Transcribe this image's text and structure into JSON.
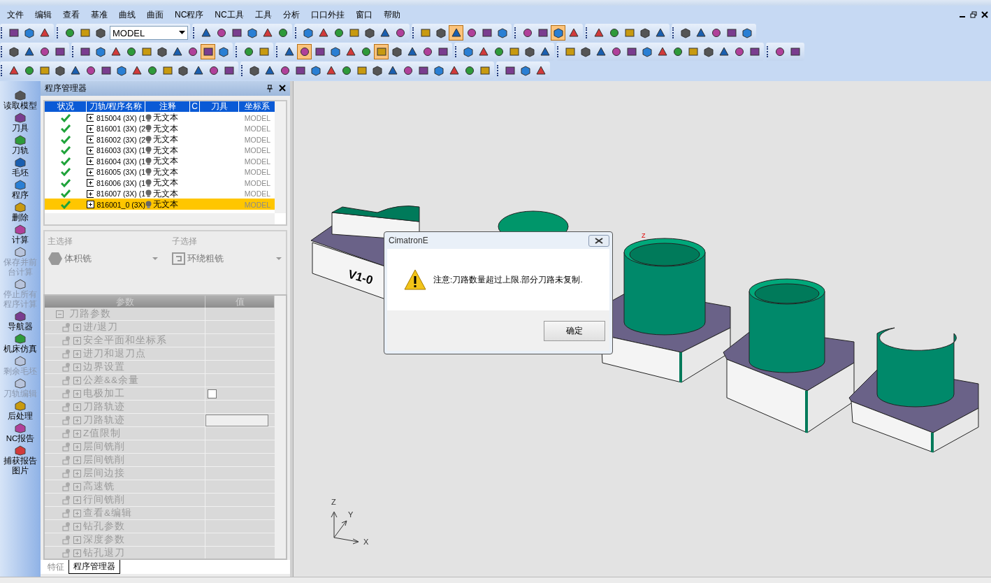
{
  "menu": [
    "文件",
    "编辑",
    "查看",
    "基准",
    "曲线",
    "曲面",
    "NC程序",
    "NC工具",
    "工具",
    "分析",
    "口口外挂",
    "窗口",
    "帮助"
  ],
  "toolbars": [
    {
      "groups": [
        {
          "buttons": [
            {
              "selected": false
            },
            {
              "selected": false
            },
            {
              "selected": false
            }
          ]
        },
        {
          "buttons": [
            {
              "selected": false
            },
            {
              "selected": false
            },
            {
              "selected": false
            }
          ],
          "combo": {
            "value": "MODEL"
          }
        },
        {
          "buttons": [
            {
              "selected": false
            },
            {
              "selected": false
            },
            {
              "selected": false
            },
            {
              "selected": false
            },
            {
              "selected": false
            },
            {
              "selected": false
            }
          ]
        },
        {
          "buttons": [
            {
              "selected": false
            },
            {
              "selected": false
            },
            {
              "selected": false
            },
            {
              "selected": false
            },
            {
              "selected": false
            },
            {
              "selected": false
            },
            {
              "selected": false
            }
          ]
        },
        {
          "buttons": [
            {
              "selected": false
            },
            {
              "selected": false
            },
            {
              "selected": true
            },
            {
              "selected": false
            },
            {
              "selected": false
            },
            {
              "selected": false
            }
          ]
        },
        {
          "buttons": [
            {
              "selected": false
            },
            {
              "selected": false
            },
            {
              "selected": true
            },
            {
              "selected": false
            }
          ]
        },
        {
          "buttons": [
            {
              "selected": false
            },
            {
              "selected": false
            },
            {
              "selected": false
            },
            {
              "selected": false
            },
            {
              "selected": false
            }
          ]
        },
        {
          "buttons": [
            {
              "selected": false
            },
            {
              "selected": false
            },
            {
              "selected": false
            },
            {
              "selected": false
            },
            {
              "selected": false
            }
          ]
        }
      ]
    },
    {
      "groups": [
        {
          "buttons": [
            {
              "selected": false
            },
            {
              "selected": false
            },
            {
              "selected": false
            },
            {
              "selected": false
            }
          ]
        },
        {
          "buttons": [
            {
              "selected": false
            },
            {
              "selected": false
            },
            {
              "selected": false
            },
            {
              "selected": false
            },
            {
              "selected": false
            },
            {
              "selected": false
            },
            {
              "selected": false
            },
            {
              "selected": false
            },
            {
              "selected": true
            },
            {
              "selected": false
            }
          ]
        },
        {
          "buttons": [
            {
              "selected": false
            },
            {
              "selected": false
            }
          ]
        },
        {
          "buttons": [
            {
              "selected": false
            },
            {
              "selected": true
            },
            {
              "selected": false
            },
            {
              "selected": false
            },
            {
              "selected": false
            },
            {
              "selected": false
            },
            {
              "selected": true
            },
            {
              "selected": false
            },
            {
              "selected": false
            },
            {
              "selected": false
            },
            {
              "selected": false
            }
          ]
        },
        {
          "buttons": [
            {
              "selected": false
            },
            {
              "selected": false
            },
            {
              "selected": false
            },
            {
              "selected": false
            },
            {
              "selected": false
            },
            {
              "selected": false
            }
          ]
        },
        {
          "buttons": [
            {
              "selected": false
            },
            {
              "selected": false
            },
            {
              "selected": false
            },
            {
              "selected": false
            },
            {
              "selected": false
            },
            {
              "selected": false
            },
            {
              "selected": false
            },
            {
              "selected": false
            },
            {
              "selected": false
            },
            {
              "selected": false
            },
            {
              "selected": false
            },
            {
              "selected": false
            },
            {
              "selected": false
            }
          ]
        },
        {
          "buttons": [
            {
              "selected": false
            },
            {
              "selected": false
            }
          ]
        }
      ]
    },
    {
      "groups": [
        {
          "buttons": [
            {
              "selected": false
            },
            {
              "selected": false
            },
            {
              "selected": false
            },
            {
              "selected": false
            },
            {
              "selected": false
            },
            {
              "selected": false
            },
            {
              "selected": false
            },
            {
              "selected": false
            },
            {
              "selected": false
            },
            {
              "selected": false
            },
            {
              "selected": false
            },
            {
              "selected": false
            },
            {
              "selected": false
            },
            {
              "selected": false
            },
            {
              "selected": false
            }
          ]
        },
        {
          "buttons": [
            {
              "selected": false
            },
            {
              "selected": false
            },
            {
              "selected": false
            },
            {
              "selected": false
            },
            {
              "selected": false
            },
            {
              "selected": false
            },
            {
              "selected": false
            },
            {
              "selected": false
            },
            {
              "selected": false
            },
            {
              "selected": false
            },
            {
              "selected": false
            },
            {
              "selected": false
            },
            {
              "selected": false
            },
            {
              "selected": false
            },
            {
              "selected": false
            },
            {
              "selected": false
            }
          ]
        },
        {
          "buttons": [
            {
              "selected": false
            },
            {
              "selected": false
            },
            {
              "selected": false
            }
          ]
        }
      ]
    }
  ],
  "sidebar": {
    "items": [
      {
        "label": "读取模型",
        "disabled": false
      },
      {
        "label": "刀具",
        "disabled": false
      },
      {
        "label": "刀轨",
        "disabled": false
      },
      {
        "label": "毛坯",
        "disabled": false
      },
      {
        "label": "程序",
        "disabled": false
      },
      {
        "label": "删除",
        "disabled": false
      },
      {
        "label": "计算",
        "disabled": false
      },
      {
        "label": "保存并前台计算",
        "disabled": true
      },
      {
        "label": "停止所有程序计算",
        "disabled": true
      },
      {
        "label": "导航器",
        "disabled": false
      },
      {
        "label": "机床仿真",
        "disabled": false
      },
      {
        "label": "剩余毛坯",
        "disabled": true
      },
      {
        "label": "刀轨编辑",
        "disabled": true
      },
      {
        "label": "后处理",
        "disabled": false
      },
      {
        "label": "NC报告",
        "disabled": false
      },
      {
        "label": "捕获报告图片",
        "disabled": false
      }
    ]
  },
  "panel": {
    "title": "程序管理器",
    "table": {
      "columns": [
        "状况",
        "刀轨/程序名称",
        "注释",
        "C",
        "刀具",
        "坐标系"
      ],
      "rows": [
        {
          "name": "815004 (3X) (1",
          "comment": "无文本",
          "coord": "MODEL",
          "selected": false
        },
        {
          "name": "816001 (3X) (2",
          "comment": "无文本",
          "coord": "MODEL",
          "selected": false
        },
        {
          "name": "816002 (3X) (2",
          "comment": "无文本",
          "coord": "MODEL",
          "selected": false
        },
        {
          "name": "816003 (3X) (1",
          "comment": "无文本",
          "coord": "MODEL",
          "selected": false
        },
        {
          "name": "816004 (3X) (1",
          "comment": "无文本",
          "coord": "MODEL",
          "selected": false
        },
        {
          "name": "816005 (3X) (1",
          "comment": "无文本",
          "coord": "MODEL",
          "selected": false
        },
        {
          "name": "816006 (3X) (1",
          "comment": "无文本",
          "coord": "MODEL",
          "selected": false
        },
        {
          "name": "816007 (3X) (1",
          "comment": "无文本",
          "coord": "MODEL",
          "selected": false
        },
        {
          "name": "816001_0 (3X)",
          "comment": "无文本",
          "coord": "MODEL",
          "selected": true
        }
      ]
    },
    "main_selection": {
      "label": "主选择",
      "value": "体积铣"
    },
    "sub_selection": {
      "label": "子选择",
      "value": "环绕粗铣"
    },
    "params": {
      "columns": [
        "参数",
        "值"
      ],
      "root": {
        "label": "刀路参数",
        "expanded": true,
        "children": [
          {
            "label": "进/退刀",
            "kind": "plain",
            "expanded": false
          },
          {
            "label": "安全平面和坐标系",
            "kind": "plain",
            "expanded": false
          },
          {
            "label": "进刀和退刀点",
            "kind": "plain",
            "expanded": false
          },
          {
            "label": "边界设置",
            "kind": "plain",
            "expanded": false
          },
          {
            "label": "公差&&余量",
            "kind": "plain",
            "expanded": false
          },
          {
            "label": "电极加工",
            "kind": "checkbox",
            "checked": false,
            "expanded": false
          },
          {
            "label": "刀路轨迹",
            "kind": "plain",
            "expanded": false
          },
          {
            "label": "刀路轨迹",
            "kind": "field",
            "expanded": false
          },
          {
            "label": "Z值限制",
            "kind": "plain",
            "expanded": false
          },
          {
            "label": "层间铣削",
            "kind": "plain",
            "expanded": false
          },
          {
            "label": "层间铣削",
            "kind": "plain",
            "expanded": false
          },
          {
            "label": "层间边接",
            "kind": "plain",
            "expanded": false
          },
          {
            "label": "高速铣",
            "kind": "plain",
            "expanded": false
          },
          {
            "label": "行间铣削",
            "kind": "plain",
            "expanded": false
          },
          {
            "label": "查看&编辑",
            "kind": "plain",
            "expanded": false
          },
          {
            "label": "钻孔参数",
            "kind": "plain",
            "expanded": false
          },
          {
            "label": "深度参数",
            "kind": "plain",
            "expanded": false
          },
          {
            "label": "钻孔退刀",
            "kind": "plain",
            "expanded": false
          }
        ]
      }
    },
    "tabs": [
      {
        "label": "特征",
        "selected": false
      },
      {
        "label": "程序管理器",
        "selected": true
      }
    ]
  },
  "viewport": {
    "part_label": "V1-0",
    "axis_labels": {
      "x": "X",
      "y": "Y",
      "z": "Z"
    },
    "marker_label": "Z"
  },
  "dialog": {
    "title": "CimatronE",
    "message": "注意:刀路数量超过上限.部分刀路未复制.",
    "button": "确定"
  }
}
